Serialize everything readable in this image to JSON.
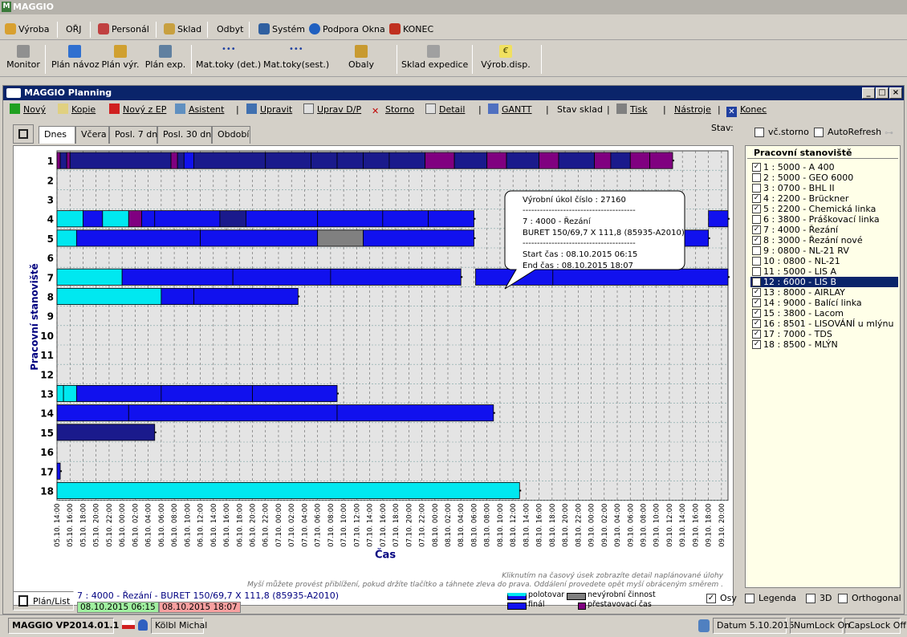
{
  "app": {
    "title": "MAGGIO"
  },
  "menu": [
    {
      "label": "Výroba",
      "icon": "production-icon",
      "color": "#d8a030"
    },
    {
      "label": "OŘJ",
      "icon": "",
      "color": ""
    },
    {
      "label": "Personál",
      "icon": "people-icon",
      "color": "#c04040"
    },
    {
      "label": "Sklad",
      "icon": "warehouse-icon",
      "color": "#c8a040"
    },
    {
      "label": "Odbyt",
      "icon": "",
      "color": ""
    },
    {
      "label": "Systém",
      "icon": "system-icon",
      "color": "#3060a0"
    },
    {
      "label": "Podpora",
      "icon": "help-icon",
      "color": "#2060c0"
    },
    {
      "label": "Okna",
      "icon": "",
      "color": ""
    },
    {
      "label": "KONEC",
      "icon": "exit-icon",
      "color": "#c03020"
    }
  ],
  "toolbar": [
    {
      "label": "Monitor"
    },
    {
      "label": "Plán návoz"
    },
    {
      "label": "Plán výr."
    },
    {
      "label": "Plán exp."
    },
    {
      "label": "Mat.toky (det.)"
    },
    {
      "label": "Mat.toky(sest.)"
    },
    {
      "label": "Obaly"
    },
    {
      "label": "Sklad expedice"
    },
    {
      "label": "Výrob.disp."
    }
  ],
  "window": {
    "title": "MAGGIO Planning"
  },
  "actions": [
    "Nový",
    "Kopie",
    "Nový z EP",
    "Asistent",
    "Upravit",
    "Uprav D/P",
    "Storno",
    "Detail",
    "GANTT",
    "Stav sklad",
    "Tisk",
    "Nástroje",
    "Konec"
  ],
  "tabs": [
    "Dnes",
    "Včera",
    "Posl. 7 dní",
    "Posl. 30 dní",
    "Období"
  ],
  "state": {
    "label": "Stav:",
    "storno": "vč.storno",
    "autorefresh": "AutoRefresh"
  },
  "panel": {
    "title": "Pracovní stanoviště",
    "items": [
      {
        "label": "1 : 5000 - A 400",
        "checked": true
      },
      {
        "label": "2 : 5000 - GEO 6000",
        "checked": false
      },
      {
        "label": "3 : 0700 - BHL II",
        "checked": false
      },
      {
        "label": "4 : 2200 - Brückner",
        "checked": true
      },
      {
        "label": "5 : 2200 - Chemická linka",
        "checked": true
      },
      {
        "label": "6 : 3800 - Práškovací linka",
        "checked": false
      },
      {
        "label": "7 : 4000 - Řezání",
        "checked": true
      },
      {
        "label": "8 : 3000 - Řezání nové",
        "checked": true
      },
      {
        "label": "9 : 0800 - NL-21 RV",
        "checked": false
      },
      {
        "label": "10 : 0800 - NL-21",
        "checked": false
      },
      {
        "label": "11 : 5000 - LIS A",
        "checked": false
      },
      {
        "label": "12 : 6000 - LIS B",
        "checked": false,
        "selected": true
      },
      {
        "label": "13 : 8000 - AIRLAY",
        "checked": true
      },
      {
        "label": "14 : 9000 - Balící linka",
        "checked": true
      },
      {
        "label": "15 : 3800 - Lacom",
        "checked": true
      },
      {
        "label": "16 : 8501 - LISOVÁNÍ u mlýnu",
        "checked": true
      },
      {
        "label": "17 : 7000 - TDS",
        "checked": true
      },
      {
        "label": "18 : 8500 - MLÝN",
        "checked": true
      }
    ]
  },
  "tooltip": {
    "line1": "Výrobní úkol číslo : 27160",
    "line2": "7 : 4000 - Řezání",
    "line3": "BURET 150/69,7 X 111,8 (85935-A2010)",
    "line4": "Start čas : 08.10.2015 06:15",
    "line5": "End čas : 08.10.2015 18:07",
    "sep": "---------------------------------------"
  },
  "hints": {
    "line1": "Kliknutím na časový úsek zobrazíte detail naplánované úlohy",
    "line2": "Myší můžete provést přiblížení, pokud držíte tlačítko a táhnete zleva do prava. Oddálení provedete opět myší obráceným směrem ."
  },
  "legend": {
    "semi": "polotovar",
    "final": "finál",
    "nonprod": "nevýrobní činnost",
    "changeover": "přestavovací čas"
  },
  "footer": {
    "planlist": "Plán/List",
    "task": "7 : 4000 - Řezání - BURET 150/69,7 X 111,8 (85935-A2010)",
    "start": "08.10.2015 06:15",
    "end": "08.10.2015 18:07",
    "osy": "Osy",
    "legenda": "Legenda",
    "d3": "3D",
    "orth": "Orthogonal"
  },
  "status": {
    "version": "MAGGIO VP2014.01.1",
    "user": "Kölbl Michal",
    "date": "Datum 5.10.2015",
    "numlock": "NumLock On",
    "capslock": "CapsLock Off"
  },
  "colors": {
    "semi": "#1111ee",
    "final": "#1a1a8c",
    "semi_light": "#00e8f0",
    "nonprod": "#808080",
    "changeover": "#800080"
  },
  "chart_data": {
    "type": "gantt",
    "ylabel": "Pracovní stanoviště",
    "xlabel": "Čas",
    "y_categories": [
      "1",
      "2",
      "3",
      "4",
      "5",
      "6",
      "7",
      "8",
      "9",
      "10",
      "11",
      "12",
      "13",
      "14",
      "15",
      "16",
      "17",
      "18"
    ],
    "x_ticks": [
      "05.10. 14:00",
      "05.10. 16:00",
      "05.10. 18:00",
      "05.10. 20:00",
      "05.10. 22:00",
      "06.10. 00:00",
      "06.10. 02:00",
      "06.10. 04:00",
      "06.10. 06:00",
      "06.10. 08:00",
      "06.10. 10:00",
      "06.10. 12:00",
      "06.10. 14:00",
      "06.10. 16:00",
      "06.10. 18:00",
      "06.10. 20:00",
      "06.10. 22:00",
      "07.10. 00:00",
      "07.10. 02:00",
      "07.10. 04:00",
      "07.10. 06:00",
      "07.10. 08:00",
      "07.10. 10:00",
      "07.10. 12:00",
      "07.10. 14:00",
      "07.10. 16:00",
      "07.10. 18:00",
      "07.10. 20:00",
      "07.10. 22:00",
      "08.10. 00:00",
      "08.10. 02:00",
      "08.10. 04:00",
      "08.10. 06:00",
      "08.10. 08:00",
      "08.10. 10:00",
      "08.10. 12:00",
      "08.10. 14:00",
      "08.10. 16:00",
      "08.10. 18:00",
      "08.10. 20:00",
      "08.10. 22:00",
      "09.10. 00:00",
      "09.10. 02:00",
      "09.10. 04:00",
      "09.10. 06:00",
      "09.10. 08:00",
      "09.10. 10:00",
      "09.10. 12:00",
      "09.10. 14:00",
      "09.10. 16:00",
      "09.10. 18:00",
      "09.10. 20:00"
    ],
    "x_start": "05.10.2015 14:00",
    "x_end": "09.10.2015 21:00",
    "bars": [
      {
        "row": "1",
        "start": "05.10. 14:00",
        "end": "05.10. 14:30",
        "kind": "changeover"
      },
      {
        "row": "1",
        "start": "05.10. 14:30",
        "end": "05.10. 15:30",
        "kind": "final"
      },
      {
        "row": "1",
        "start": "05.10. 15:30",
        "end": "05.10. 16:00",
        "kind": "changeover"
      },
      {
        "row": "1",
        "start": "05.10. 16:00",
        "end": "06.10. 07:30",
        "kind": "final"
      },
      {
        "row": "1",
        "start": "06.10. 07:30",
        "end": "06.10. 08:30",
        "kind": "changeover"
      },
      {
        "row": "1",
        "start": "06.10. 08:30",
        "end": "06.10. 09:30",
        "kind": "final"
      },
      {
        "row": "1",
        "start": "06.10. 09:30",
        "end": "06.10. 11:00",
        "kind": "semi"
      },
      {
        "row": "1",
        "start": "06.10. 11:00",
        "end": "06.10. 22:00",
        "kind": "final"
      },
      {
        "row": "1",
        "start": "06.10. 22:00",
        "end": "07.10. 05:00",
        "kind": "final"
      },
      {
        "row": "1",
        "start": "07.10. 05:00",
        "end": "07.10. 09:00",
        "kind": "final"
      },
      {
        "row": "1",
        "start": "07.10. 09:00",
        "end": "07.10. 13:00",
        "kind": "final"
      },
      {
        "row": "1",
        "start": "07.10. 13:00",
        "end": "07.10. 17:00",
        "kind": "final"
      },
      {
        "row": "1",
        "start": "07.10. 17:00",
        "end": "07.10. 22:30",
        "kind": "final"
      },
      {
        "row": "1",
        "start": "07.10. 22:30",
        "end": "08.10. 03:00",
        "kind": "changeover"
      },
      {
        "row": "1",
        "start": "08.10. 03:00",
        "end": "08.10. 08:00",
        "kind": "final"
      },
      {
        "row": "1",
        "start": "08.10. 08:00",
        "end": "08.10. 11:00",
        "kind": "changeover"
      },
      {
        "row": "1",
        "start": "08.10. 11:00",
        "end": "08.10. 16:00",
        "kind": "final"
      },
      {
        "row": "1",
        "start": "08.10. 16:00",
        "end": "08.10. 19:00",
        "kind": "changeover"
      },
      {
        "row": "1",
        "start": "08.10. 19:00",
        "end": "09.10. 00:30",
        "kind": "final"
      },
      {
        "row": "1",
        "start": "09.10. 00:30",
        "end": "09.10. 03:00",
        "kind": "changeover"
      },
      {
        "row": "1",
        "start": "09.10. 03:00",
        "end": "09.10. 06:00",
        "kind": "final"
      },
      {
        "row": "1",
        "start": "09.10. 06:00",
        "end": "09.10. 09:00",
        "kind": "changeover"
      },
      {
        "row": "1",
        "start": "09.10. 09:00",
        "end": "09.10. 12:30",
        "kind": "changeover"
      },
      {
        "row": "4",
        "start": "05.10. 14:00",
        "end": "05.10. 18:00",
        "kind": "semi_light"
      },
      {
        "row": "4",
        "start": "05.10. 18:00",
        "end": "05.10. 21:00",
        "kind": "semi"
      },
      {
        "row": "4",
        "start": "05.10. 21:00",
        "end": "06.10. 01:00",
        "kind": "semi_light"
      },
      {
        "row": "4",
        "start": "06.10. 01:00",
        "end": "06.10. 03:00",
        "kind": "changeover"
      },
      {
        "row": "4",
        "start": "06.10. 03:00",
        "end": "06.10. 05:00",
        "kind": "semi"
      },
      {
        "row": "4",
        "start": "06.10. 05:00",
        "end": "06.10. 15:00",
        "kind": "semi"
      },
      {
        "row": "4",
        "start": "06.10. 15:00",
        "end": "06.10. 19:00",
        "kind": "final"
      },
      {
        "row": "4",
        "start": "06.10. 19:00",
        "end": "07.10. 06:00",
        "kind": "semi"
      },
      {
        "row": "4",
        "start": "07.10. 06:00",
        "end": "07.10. 16:00",
        "kind": "semi"
      },
      {
        "row": "4",
        "start": "07.10. 16:00",
        "end": "07.10. 23:00",
        "kind": "semi"
      },
      {
        "row": "4",
        "start": "07.10. 23:00",
        "end": "08.10. 06:00",
        "kind": "semi"
      },
      {
        "row": "4",
        "start": "09.10. 18:00",
        "end": "09.10. 21:00",
        "kind": "semi"
      },
      {
        "row": "5",
        "start": "05.10. 14:00",
        "end": "05.10. 17:00",
        "kind": "semi_light"
      },
      {
        "row": "5",
        "start": "05.10. 17:00",
        "end": "06.10. 12:00",
        "kind": "semi"
      },
      {
        "row": "5",
        "start": "06.10. 12:00",
        "end": "07.10. 06:00",
        "kind": "semi"
      },
      {
        "row": "5",
        "start": "07.10. 06:00",
        "end": "07.10. 13:00",
        "kind": "nonprod"
      },
      {
        "row": "5",
        "start": "07.10. 13:00",
        "end": "08.10. 06:00",
        "kind": "semi"
      },
      {
        "row": "5",
        "start": "09.10. 12:00",
        "end": "09.10. 18:00",
        "kind": "semi"
      },
      {
        "row": "7",
        "start": "05.10. 14:00",
        "end": "06.10. 00:00",
        "kind": "semi_light"
      },
      {
        "row": "7",
        "start": "06.10. 00:00",
        "end": "06.10. 17:00",
        "kind": "semi"
      },
      {
        "row": "7",
        "start": "06.10. 17:00",
        "end": "07.10. 08:00",
        "kind": "semi"
      },
      {
        "row": "7",
        "start": "07.10. 08:00",
        "end": "08.10. 04:00",
        "kind": "semi"
      },
      {
        "row": "7",
        "start": "08.10. 06:15",
        "end": "08.10. 18:07",
        "kind": "semi"
      },
      {
        "row": "7",
        "start": "08.10. 18:07",
        "end": "09.10. 21:00",
        "kind": "semi"
      },
      {
        "row": "8",
        "start": "05.10. 14:00",
        "end": "06.10. 06:00",
        "kind": "semi_light"
      },
      {
        "row": "8",
        "start": "06.10. 06:00",
        "end": "06.10. 11:00",
        "kind": "semi"
      },
      {
        "row": "8",
        "start": "06.10. 11:00",
        "end": "07.10. 03:00",
        "kind": "semi"
      },
      {
        "row": "13",
        "start": "05.10. 14:00",
        "end": "05.10. 15:00",
        "kind": "semi_light"
      },
      {
        "row": "13",
        "start": "05.10. 15:00",
        "end": "05.10. 17:00",
        "kind": "semi_light"
      },
      {
        "row": "13",
        "start": "05.10. 17:00",
        "end": "06.10. 06:00",
        "kind": "semi"
      },
      {
        "row": "13",
        "start": "06.10. 06:00",
        "end": "06.10. 20:00",
        "kind": "semi"
      },
      {
        "row": "13",
        "start": "06.10. 20:00",
        "end": "07.10. 09:00",
        "kind": "semi"
      },
      {
        "row": "14",
        "start": "05.10. 14:00",
        "end": "06.10. 01:00",
        "kind": "semi"
      },
      {
        "row": "14",
        "start": "06.10. 01:00",
        "end": "07.10. 09:00",
        "kind": "semi"
      },
      {
        "row": "14",
        "start": "07.10. 09:00",
        "end": "08.10. 09:00",
        "kind": "semi"
      },
      {
        "row": "15",
        "start": "05.10. 14:00",
        "end": "06.10. 05:00",
        "kind": "final"
      },
      {
        "row": "17",
        "start": "05.10. 14:00",
        "end": "05.10. 14:30",
        "kind": "semi"
      },
      {
        "row": "18",
        "start": "05.10. 14:00",
        "end": "08.10. 13:00",
        "kind": "semi_light"
      }
    ],
    "grid": true,
    "legend": "bottom"
  }
}
